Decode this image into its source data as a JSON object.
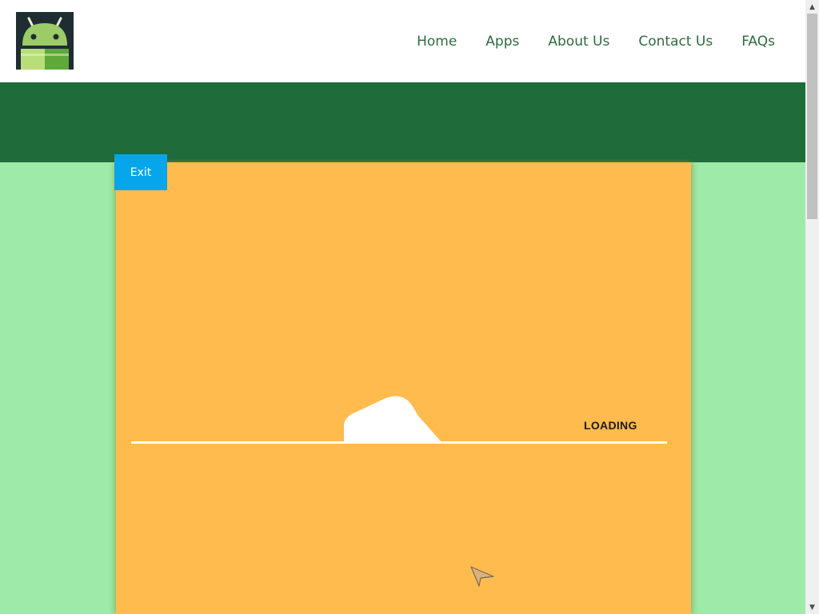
{
  "header": {
    "logo_name": "android-logo",
    "nav": [
      {
        "label": "Home"
      },
      {
        "label": "Apps"
      },
      {
        "label": "About Us"
      },
      {
        "label": "Contact Us"
      },
      {
        "label": "FAQs"
      }
    ]
  },
  "game": {
    "exit_label": "Exit",
    "loading_text": "LOADING"
  },
  "colors": {
    "banner": "#1f6b39",
    "page_background": "#9eeaa9",
    "game_background": "#ffbb4d",
    "exit_button": "#06a6ec",
    "nav_text": "#2e6b3e"
  },
  "scrollbar": {
    "up_icon": "▲",
    "down_icon": "▼"
  }
}
